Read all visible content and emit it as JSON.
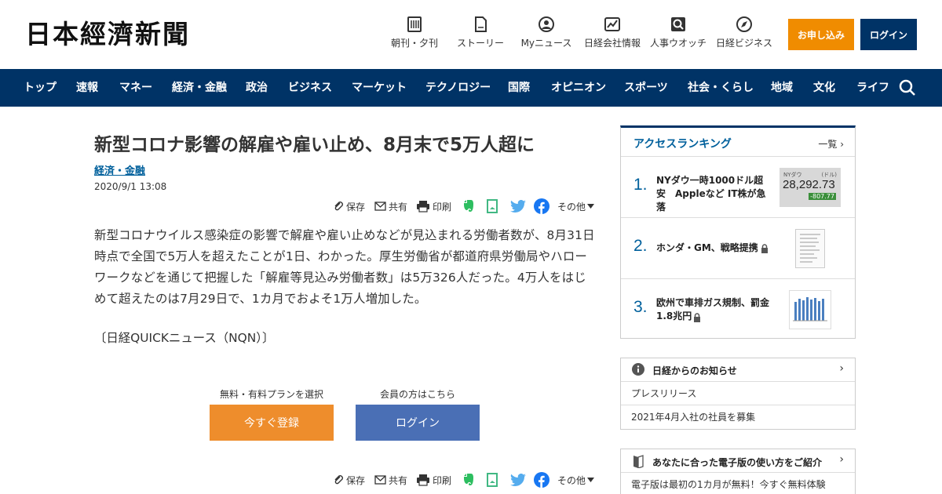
{
  "header": {
    "logo": "日本經濟新聞",
    "utility": [
      {
        "label": "朝刊・夕刊",
        "icon": "newspaper-icon"
      },
      {
        "label": "ストーリー",
        "icon": "document-icon"
      },
      {
        "label": "Myニュース",
        "icon": "user-icon"
      },
      {
        "label": "日経会社情報",
        "icon": "chart-icon"
      },
      {
        "label": "人事ウオッチ",
        "icon": "magnifier-icon"
      },
      {
        "label": "日経ビジネス",
        "icon": "compass-icon"
      }
    ],
    "subscribe": "お申し込み",
    "login": "ログイン"
  },
  "nav": [
    "トップ",
    "速報",
    "マネー",
    "経済・金融",
    "政治",
    "ビジネス",
    "マーケット",
    "テクノロジー",
    "国際",
    "オピニオン",
    "スポーツ",
    "社会・くらし",
    "地域",
    "文化",
    "ライフ"
  ],
  "article": {
    "title": "新型コロナ影響の解雇や雇い止め、8月末で5万人超に",
    "category": "経済・金融",
    "date": "2020/9/1 13:08",
    "share": {
      "save": "保存",
      "share": "共有",
      "print": "印刷",
      "more": "その他"
    },
    "body": "新型コロナウイルス感染症の影響で解雇や雇い止めなどが見込まれる労働者数が、8月31日時点で全国で5万人を超えたことが1日、わかった。厚生労働省が都道府県労働局やハローワークなどを通じて把握した「解雇等見込み労働者数」は5万326人だった。4万人をはじめて超えたのは7月29日で、1カ月でおよそ1万人増加した。",
    "source": "〔日経QUICKニュース（NQN）〕",
    "plan_label": "無料・有料プランを選択",
    "member_label": "会員の方はこちら",
    "register_button": "今すぐ登録",
    "login_button": "ログイン"
  },
  "ranking": {
    "title": "アクセスランキング",
    "more": "一覧",
    "items": [
      {
        "rank": "1.",
        "text": "NYダウ一時1000ドル超安　Appleなど IT株が急落",
        "thumb_title": "NYダウ",
        "thumb_unit": "(ドル)",
        "thumb_value": "28,292.73",
        "thumb_change": "-807.77"
      },
      {
        "rank": "2.",
        "text": "ホンダ・GM、戦略提携",
        "locked": true
      },
      {
        "rank": "3.",
        "text": "欧州で車排ガス規制、罰金1.8兆円",
        "locked": true
      }
    ]
  },
  "news": {
    "title": "日経からのお知らせ",
    "items": [
      "プレスリリース",
      "2021年4月入社の社員を募集"
    ]
  },
  "guide": {
    "title": "あなたに合った電子版の使い方をご紹介",
    "text": "電子版は最初の1カ月が無料！今すぐ無料体験"
  },
  "colors": {
    "brand": "#003366",
    "accent": "#f08c00",
    "link": "#00609c",
    "register": "#ee8d2c",
    "login_btn": "#4a6fb5"
  }
}
